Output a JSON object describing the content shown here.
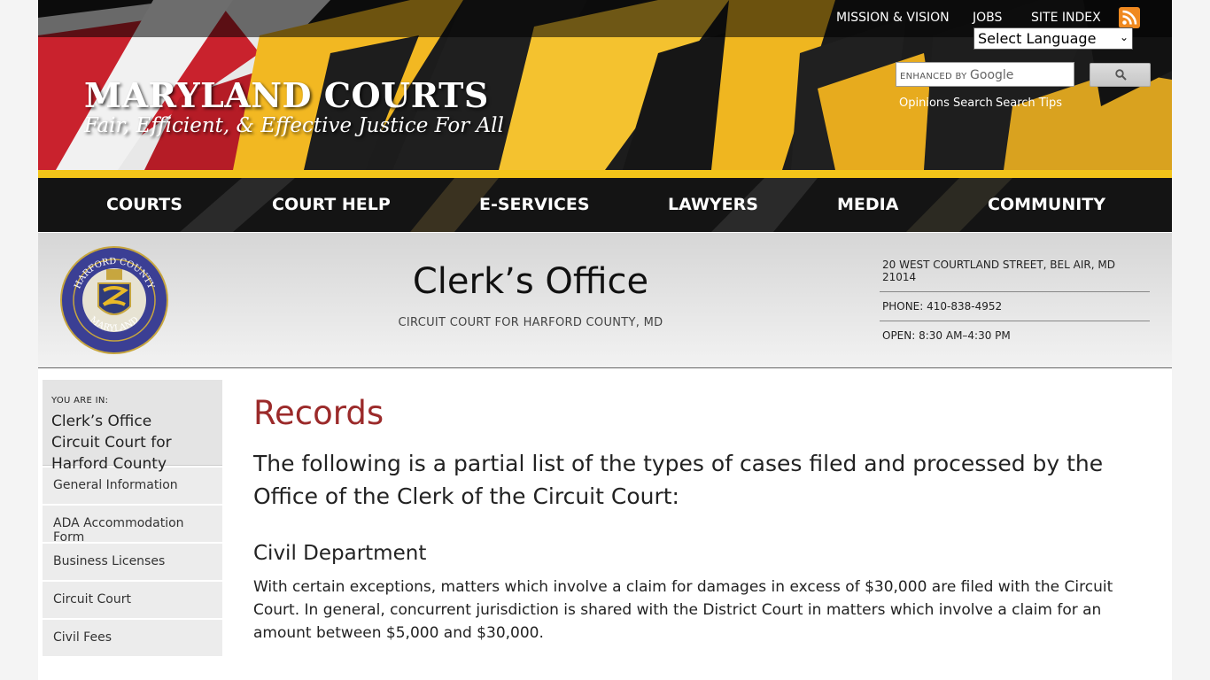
{
  "header": {
    "brand": "MARYLAND COURTS",
    "tagline": "Fair, Efficient, & Effective Justice For All",
    "top_links": [
      "MISSION & VISION",
      "JOBS",
      "SITE INDEX"
    ],
    "language_select": "Select Language",
    "search_enhanced": "ENHANCED BY",
    "search_google": "Google",
    "sub_links": [
      "Opinions Search",
      "Search Tips"
    ]
  },
  "nav": {
    "items": [
      "COURTS",
      "COURT HELP",
      "E-SERVICES",
      "LAWYERS",
      "MEDIA",
      "COMMUNITY"
    ]
  },
  "banner": {
    "title": "Clerk’s Office",
    "subtitle": "CIRCUIT COURT FOR HARFORD COUNTY, MD",
    "seal_top": "HARFORD COUNTY",
    "seal_bottom": "MARYLAND",
    "address": "20 WEST COURTLAND STREET, BEL AIR, MD 21014",
    "phone": "PHONE: 410-838-4952",
    "hours": "OPEN: 8:30 AM–4:30 PM"
  },
  "sidebar": {
    "you_are_in": "YOU ARE IN:",
    "path_1": "Clerk’s Office",
    "path_2": "Circuit Court for Harford County",
    "items": [
      "General Information",
      "ADA Accommodation Form",
      "Business Licenses",
      "Circuit Court",
      "Civil Fees"
    ]
  },
  "content": {
    "title": "Records",
    "lead": "The following is a partial list of the types of cases filed and processed by the Office of the Clerk of the Circuit Court:",
    "section_title": "Civil Department",
    "paragraph": "With certain exceptions, matters which involve a claim for damages in excess of $30,000 are filed with the Circuit Court. In general, concurrent jurisdiction is shared with the District Court in matters which involve a claim for an amount between $5,000 and $30,000."
  },
  "colors": {
    "gold": "#f3c419",
    "title_red": "#9b2a2a",
    "rss_orange": "#f0891f"
  }
}
